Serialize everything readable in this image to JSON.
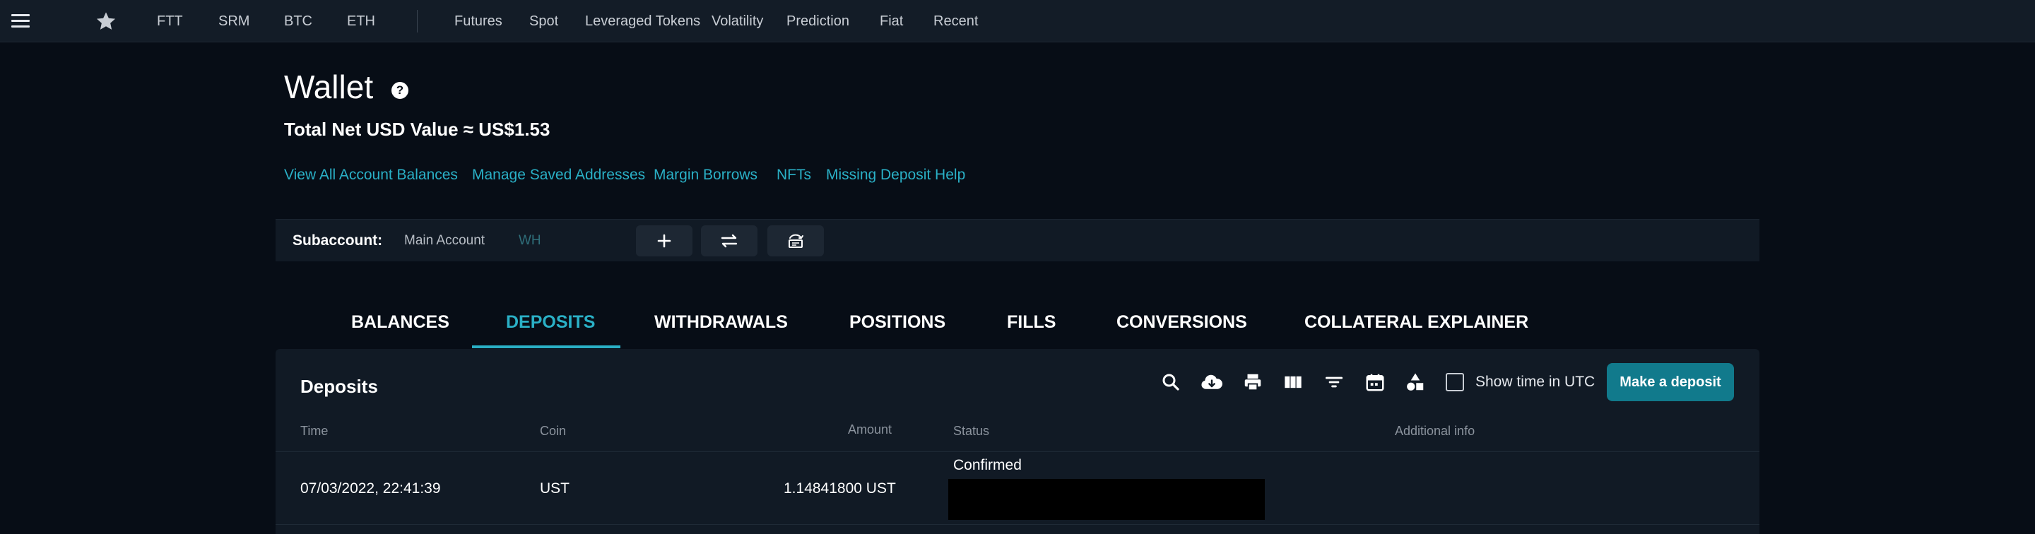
{
  "nav": {
    "markets": [
      "FTT",
      "SRM",
      "BTC",
      "ETH"
    ],
    "sections": [
      "Futures",
      "Spot",
      "Leveraged Tokens",
      "Volatility",
      "Prediction",
      "Fiat",
      "Recent"
    ]
  },
  "wallet": {
    "title": "Wallet",
    "help_glyph": "?",
    "net_value": "Total Net USD Value ≈ US$1.53",
    "links": [
      "View All Account Balances",
      "Manage Saved Addresses",
      "Margin Borrows",
      "NFTs",
      "Missing Deposit Help"
    ]
  },
  "subaccount": {
    "label": "Subaccount:",
    "options": [
      "Main Account",
      "WH"
    ],
    "active": "WH"
  },
  "tabs": [
    "BALANCES",
    "DEPOSITS",
    "WITHDRAWALS",
    "POSITIONS",
    "FILLS",
    "CONVERSIONS",
    "COLLATERAL EXPLAINER"
  ],
  "active_tab": "DEPOSITS",
  "deposits": {
    "title": "Deposits",
    "utc_label": "Show time in UTC",
    "utc_checked": false,
    "make_deposit": "Make a deposit",
    "columns": [
      "Time",
      "Coin",
      "Amount",
      "Status",
      "Additional info"
    ],
    "rows": [
      {
        "time": "07/03/2022, 22:41:39",
        "coin": "UST",
        "amount": "1.14841800 UST",
        "status": "Confirmed",
        "additional": ""
      }
    ]
  },
  "icons": {
    "menu": "menu-icon",
    "star": "star-icon",
    "help": "help-icon",
    "add": "plus-icon",
    "transfer": "transfer-icon",
    "history": "history-icon",
    "search": "search-icon",
    "download": "download-icon",
    "print": "print-icon",
    "columns": "columns-icon",
    "filter": "filter-icon",
    "calendar": "calendar-icon",
    "shapes": "shapes-icon"
  },
  "colors": {
    "accent": "#2ab0c6",
    "button": "#117a8c",
    "background": "#070d16",
    "panel": "#111a25"
  }
}
